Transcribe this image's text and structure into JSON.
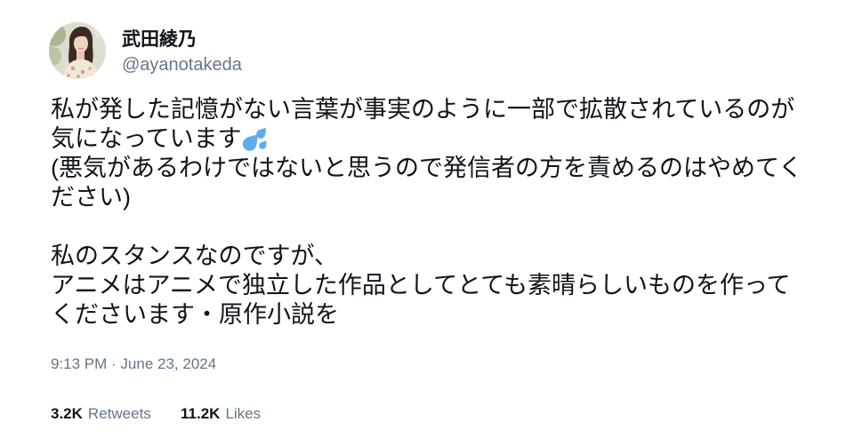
{
  "author": {
    "display_name": "武田綾乃",
    "handle": "@ayanotakeda"
  },
  "tweet": {
    "paragraphs": [
      {
        "lines": [
          "私が発した記憶がない言葉が事実のように一部で拡散されているのが",
          "気になっています",
          "(悪気があるわけではないと思うので発信者の方を責めるのはやめてく",
          "ださい)"
        ]
      },
      {
        "lines": [
          "私のスタンスなのですが、",
          "アニメはアニメで独立した作品としてとても素晴らしいものを作って",
          "くださいます・原作小説を"
        ]
      }
    ],
    "emoji_icon": "sweat-droplets-icon",
    "timestamp": "9:13 PM · June 23, 2024"
  },
  "stats": {
    "retweets": {
      "count": "3.2K",
      "label": "Retweets"
    },
    "likes": {
      "count": "11.2K",
      "label": "Likes"
    }
  },
  "colors": {
    "background": "#ffffff",
    "text": "#0f1419",
    "secondary": "#657786",
    "emoji": "#5dadec"
  }
}
